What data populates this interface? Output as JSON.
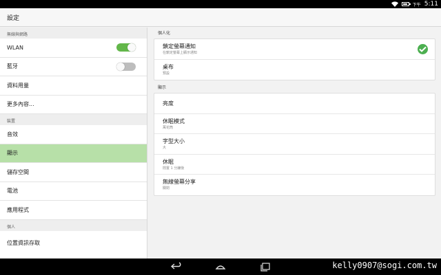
{
  "status_bar": {
    "ampm": "下午",
    "time": "5:11",
    "battery_level": 0.9
  },
  "title": "設定",
  "sidebar": {
    "sections": [
      {
        "header": "無線與網路",
        "items": [
          {
            "label": "WLAN",
            "toggle": true
          },
          {
            "label": "藍牙",
            "toggle": false
          },
          {
            "label": "資料用量"
          },
          {
            "label": "更多內容..."
          }
        ]
      },
      {
        "header": "裝置",
        "items": [
          {
            "label": "音效"
          },
          {
            "label": "顯示",
            "selected": true
          },
          {
            "label": "儲存空間"
          },
          {
            "label": "電池"
          },
          {
            "label": "應用程式"
          }
        ]
      },
      {
        "header": "個人",
        "items": [
          {
            "label": "位置資訊存取"
          }
        ]
      }
    ]
  },
  "content": {
    "personalize": {
      "header": "個人化",
      "items": [
        {
          "title": "鎖定螢幕通知",
          "subtitle": "在鎖定螢幕上顯示通知",
          "checked": true
        },
        {
          "title": "桌布",
          "subtitle": "預設"
        }
      ]
    },
    "display": {
      "header": "顯示",
      "items": [
        {
          "title": "亮度"
        },
        {
          "title": "休眠模式",
          "subtitle": "萬花筒"
        },
        {
          "title": "字型大小",
          "subtitle": "大"
        },
        {
          "title": "休眠",
          "subtitle": "閒置 1 分鐘後"
        },
        {
          "title": "無線螢幕分享",
          "subtitle": "關閉"
        }
      ]
    }
  },
  "watermark": "kelly0907@sogi.com.tw",
  "colors": {
    "accent": "#63b74a",
    "selected_bg": "#b7e0a8",
    "check": "#4caf50"
  }
}
